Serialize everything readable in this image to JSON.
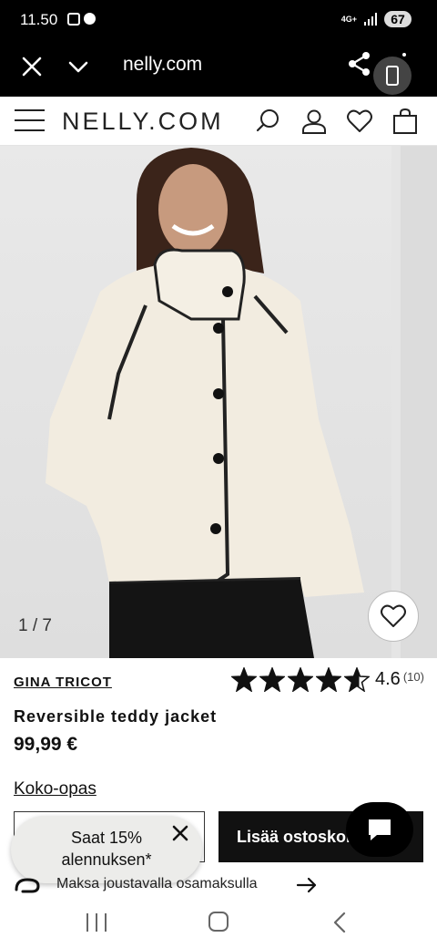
{
  "status_bar": {
    "time": "11.50",
    "network": "4G+",
    "battery": "67",
    "icons": [
      "screenshot-icon",
      "brightness-icon",
      "signal-icon",
      "battery-icon"
    ]
  },
  "browser": {
    "url": "nelly.com",
    "icons": [
      "close-icon",
      "chevron-down-icon",
      "share-icon",
      "tab-switcher-icon",
      "menu-icon"
    ]
  },
  "site_header": {
    "logo": "NELLY.COM",
    "icons": [
      "menu-icon",
      "search-icon",
      "account-icon",
      "wishlist-icon",
      "cart-icon"
    ]
  },
  "gallery": {
    "counter": "1 / 7",
    "current": 1,
    "total": 7
  },
  "product": {
    "brand": "GINA TRICOT",
    "name": "Reversible teddy jacket",
    "price": "99,99 €",
    "rating": "4.6",
    "rating_value": 4.6,
    "rating_max": 5,
    "review_count": "(10)",
    "size_guide": "Koko-opas",
    "add_to_cart": "Lisää ostoskoriin"
  },
  "promo_toast": {
    "line1": "Saat 15%",
    "line2": "alennuksen*"
  },
  "klarna": {
    "text": "Maksa joustavalla osamaksulla"
  },
  "colors": {
    "accent": "#111111",
    "header_bg": "#000000",
    "toast_bg": "#ececea"
  }
}
